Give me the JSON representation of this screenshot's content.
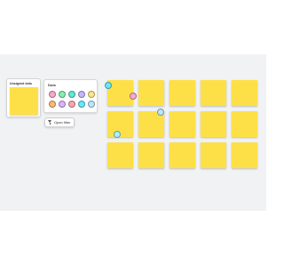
{
  "template": {
    "title": "Unsigned dots"
  },
  "dots_panel": {
    "title": "Dots",
    "dots": [
      {
        "name": "pink",
        "color": "#f9a8c9"
      },
      {
        "name": "green",
        "color": "#86efac"
      },
      {
        "name": "teal",
        "color": "#5eead4"
      },
      {
        "name": "lavender",
        "color": "#c4b5fd"
      },
      {
        "name": "cream",
        "color": "#fde68a"
      },
      {
        "name": "orange",
        "color": "#fdba74"
      },
      {
        "name": "violet",
        "color": "#d8b4fe"
      },
      {
        "name": "rose",
        "color": "#fda4af"
      },
      {
        "name": "cyan",
        "color": "#67e8f9"
      },
      {
        "name": "sky",
        "color": "#bae6fd"
      }
    ]
  },
  "filter_button": {
    "label": "Open filter",
    "icon": "filter-icon"
  },
  "grid": {
    "rows": 3,
    "columns": 5,
    "sticky_color": "#fde047"
  },
  "placed_dots": [
    {
      "color": "#67e8f9",
      "row": 1,
      "col": 1,
      "corner": "top-left"
    },
    {
      "color": "#f9a8c9",
      "row": 1,
      "col": 1,
      "corner": "bottom-right"
    },
    {
      "color": "#bae6fd",
      "row": 2,
      "col": 2,
      "corner": "top-right"
    },
    {
      "color": "#a5f3fc",
      "row": 2,
      "col": 1,
      "corner": "bottom-left"
    }
  ],
  "colors": {
    "canvas_background": "#f1f2f4",
    "sticky": "#fde047"
  }
}
